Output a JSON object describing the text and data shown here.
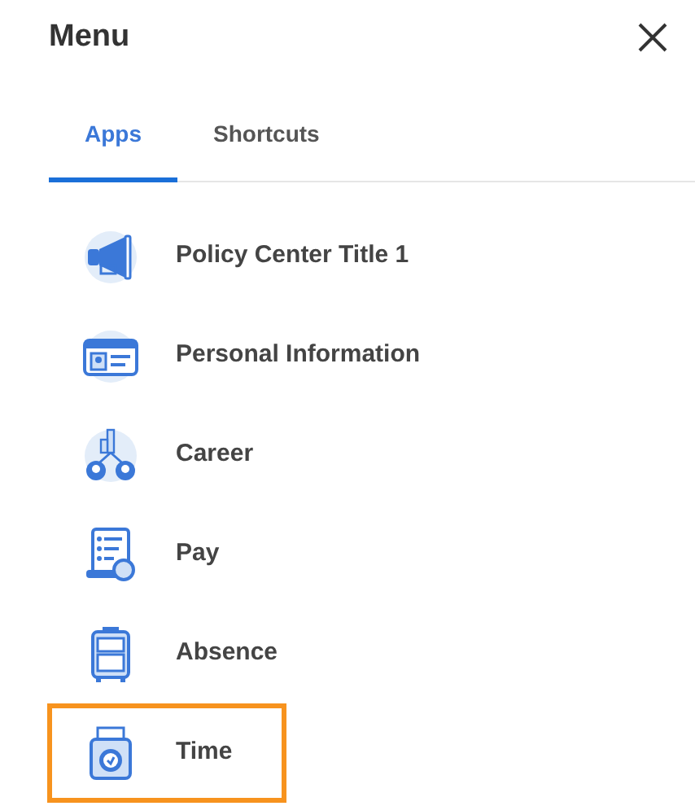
{
  "title": "Menu",
  "tabs": [
    {
      "label": "Apps",
      "selected": true
    },
    {
      "label": "Shortcuts",
      "selected": false
    }
  ],
  "apps": [
    {
      "kind": "megaphone",
      "label": "Policy Center Title 1",
      "highlighted": false
    },
    {
      "kind": "id-card",
      "label": "Personal Information",
      "highlighted": false
    },
    {
      "kind": "career",
      "label": "Career",
      "highlighted": false
    },
    {
      "kind": "pay",
      "label": "Pay",
      "highlighted": false
    },
    {
      "kind": "absence",
      "label": "Absence",
      "highlighted": false
    },
    {
      "kind": "time",
      "label": "Time",
      "highlighted": true
    }
  ]
}
